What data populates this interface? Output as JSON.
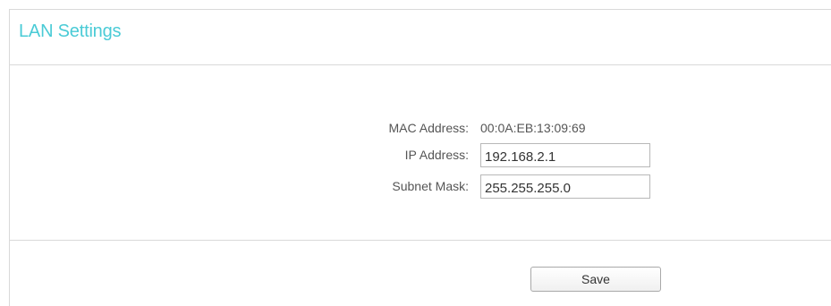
{
  "page": {
    "title": "LAN Settings"
  },
  "form": {
    "mac_label": "MAC Address:",
    "mac_value": "00:0A:EB:13:09:69",
    "ip_label": "IP Address:",
    "ip_value": "192.168.2.1",
    "subnet_label": "Subnet Mask:",
    "subnet_value": "255.255.255.0"
  },
  "actions": {
    "save_label": "Save"
  },
  "colors": {
    "title": "#4acbd6",
    "label_text": "#555555",
    "divider": "#d9d9d9",
    "input_border": "#b8b8b8"
  }
}
